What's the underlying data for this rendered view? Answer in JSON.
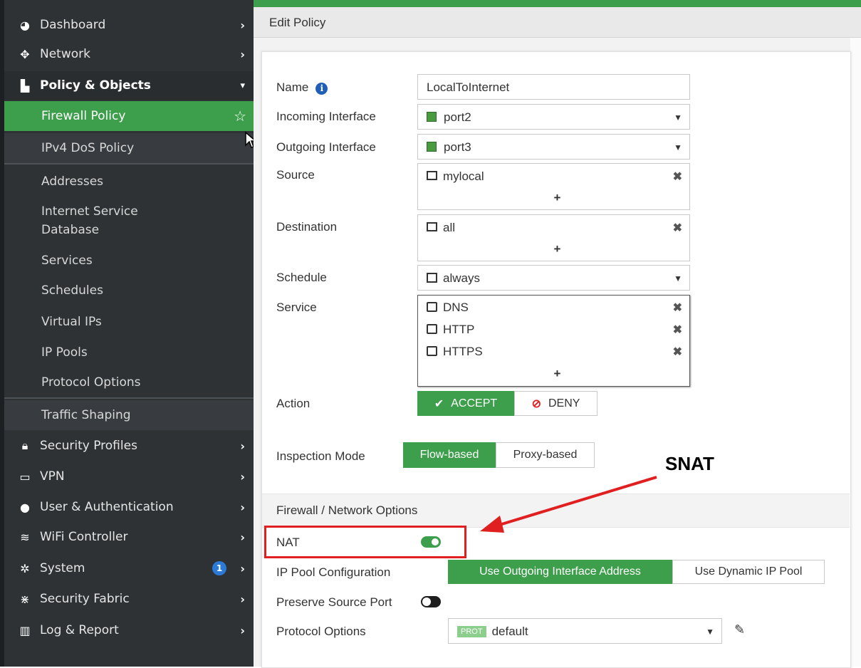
{
  "sidebar": {
    "top_items": [
      {
        "label": "Dashboard",
        "icon": "dashboard-icon"
      },
      {
        "label": "Network",
        "icon": "network-icon"
      }
    ],
    "policy_objects": {
      "label": "Policy & Objects",
      "icon": "policy-icon",
      "children": [
        "Firewall Policy",
        "IPv4 DoS Policy",
        "Addresses",
        "Internet Service Database",
        "Services",
        "Schedules",
        "Virtual IPs",
        "IP Pools",
        "Protocol Options",
        "Traffic Shaping"
      ]
    },
    "bottom_items": [
      {
        "label": "Security Profiles",
        "icon": "lock-icon"
      },
      {
        "label": "VPN",
        "icon": "laptop-icon"
      },
      {
        "label": "User & Authentication",
        "icon": "user-icon"
      },
      {
        "label": "WiFi Controller",
        "icon": "wifi-icon"
      },
      {
        "label": "System",
        "icon": "gear-icon",
        "badge": "1"
      },
      {
        "label": "Security Fabric",
        "icon": "fabric-icon"
      },
      {
        "label": "Log & Report",
        "icon": "chart-icon"
      }
    ]
  },
  "header": {
    "title": "Edit Policy"
  },
  "form": {
    "name_label": "Name",
    "name_value": "LocalToInternet",
    "incoming_label": "Incoming Interface",
    "incoming_value": "port2",
    "outgoing_label": "Outgoing Interface",
    "outgoing_value": "port3",
    "source_label": "Source",
    "source_value": "mylocal",
    "destination_label": "Destination",
    "destination_value": "all",
    "schedule_label": "Schedule",
    "schedule_value": "always",
    "service_label": "Service",
    "services": [
      "DNS",
      "HTTP",
      "HTTPS"
    ],
    "plus": "+",
    "action_label": "Action",
    "accept_label": "ACCEPT",
    "deny_label": "DENY",
    "inspection_label": "Inspection Mode",
    "flow_label": "Flow-based",
    "proxy_label": "Proxy-based",
    "section_title": "Firewall / Network Options",
    "nat_label": "NAT",
    "nat_enabled": true,
    "ippool_label": "IP Pool Configuration",
    "ippool_outgoing": "Use Outgoing Interface Address",
    "ippool_dynamic": "Use Dynamic IP Pool",
    "preserve_label": "Preserve Source Port",
    "preserve_enabled": false,
    "protocol_label": "Protocol Options",
    "protocol_tag": "PROT",
    "protocol_value": "default"
  },
  "annotation": {
    "text": "SNAT",
    "color": "#e02020"
  },
  "colors": {
    "accent": "#3d9f4b",
    "sidebar": "#2e3235",
    "info": "#1f5fb8"
  }
}
